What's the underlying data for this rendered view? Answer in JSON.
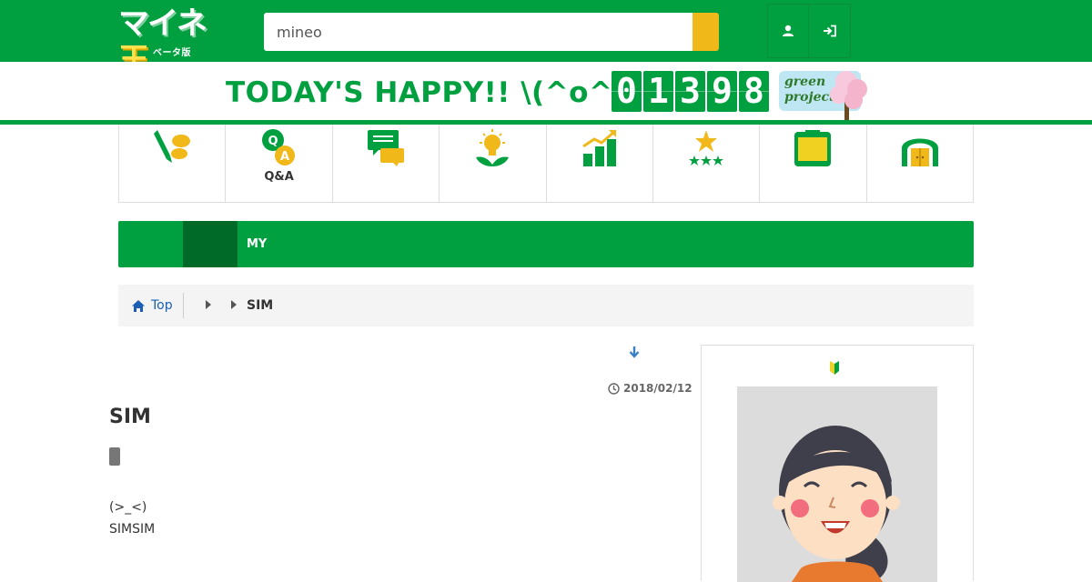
{
  "header": {
    "logo_main": "マイネ",
    "logo_tama": "王",
    "logo_sub": "ベータ版",
    "search": {
      "value": "mineo",
      "placeholder": "mineo"
    },
    "icons": [
      "user-icon",
      "login-icon",
      "search-icon"
    ]
  },
  "happy_banner": {
    "text": "TODAY'S HAPPY!! \\(^o^)/",
    "counter_digits": [
      "0",
      "1",
      "3",
      "9",
      "8"
    ],
    "green_project_line1": "green",
    "green_project_line2": "project",
    "green_project_arrow": "›"
  },
  "category_nav": {
    "items": [
      {
        "label": "",
        "icon": "pen-chat-icon"
      },
      {
        "label": "Q&A",
        "icon": "qa-icon"
      },
      {
        "label": "",
        "icon": "chat-bubbles-icon"
      },
      {
        "label": "",
        "icon": "lightbulb-icon"
      },
      {
        "label": "",
        "icon": "growth-chart-icon"
      },
      {
        "label": "",
        "icon": "stars-icon"
      },
      {
        "label": "",
        "icon": "box-icon"
      },
      {
        "label": "",
        "icon": "door-icon"
      }
    ]
  },
  "my_bar": {
    "label": "MY"
  },
  "breadcrumb": {
    "top_label": "Top",
    "current": "SIM"
  },
  "article": {
    "date": "2018/02/12",
    "title": "SIM",
    "body_lines": [
      "(>_<)",
      "SIMSIM"
    ]
  },
  "colors": {
    "brand_green": "#00a040",
    "dark_green": "#006b28",
    "search_button": "#f0b818",
    "link_blue": "#1a5fb4"
  }
}
